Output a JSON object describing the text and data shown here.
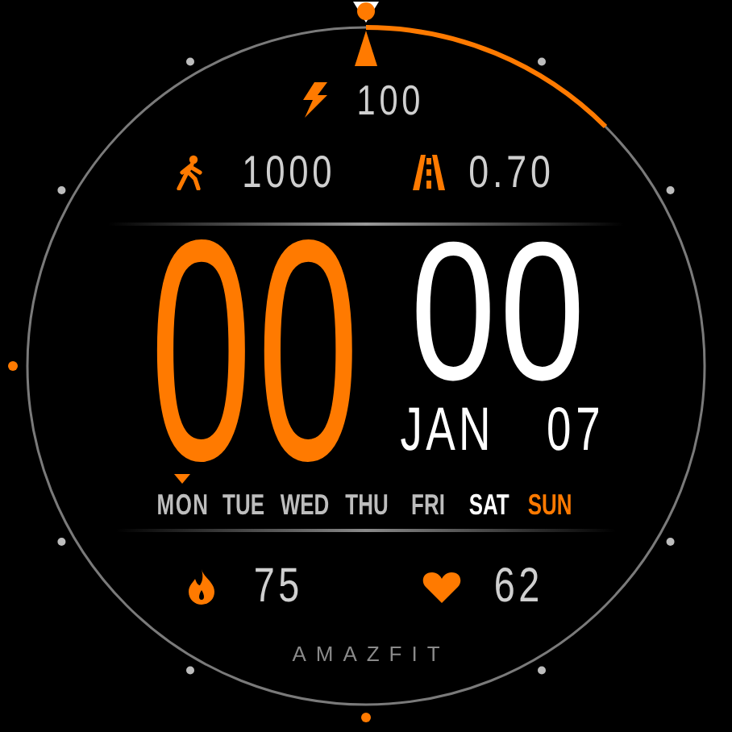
{
  "battery": {
    "value": "100"
  },
  "steps": {
    "value": "1000"
  },
  "distance": {
    "value": "0.70"
  },
  "time": {
    "hours": "00",
    "minutes": "00"
  },
  "date": {
    "month": "JAN",
    "day": "07"
  },
  "weekdays": [
    {
      "label": "MON",
      "kind": "weekday",
      "selected": true
    },
    {
      "label": "TUE",
      "kind": "weekday",
      "selected": false
    },
    {
      "label": "WED",
      "kind": "weekday",
      "selected": false
    },
    {
      "label": "THU",
      "kind": "weekday",
      "selected": false
    },
    {
      "label": "FRI",
      "kind": "weekday",
      "selected": false
    },
    {
      "label": "SAT",
      "kind": "saturday",
      "selected": false
    },
    {
      "label": "SUN",
      "kind": "sunday",
      "selected": false
    }
  ],
  "calories": {
    "value": "75"
  },
  "heart_rate": {
    "value": "62"
  },
  "brand": "AMAZFIT"
}
